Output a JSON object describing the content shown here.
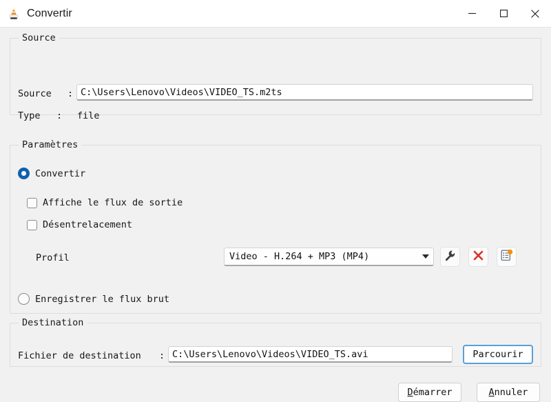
{
  "window": {
    "title": "Convertir",
    "app_icon": "vlc-cone-icon",
    "controls": {
      "minimize": "minimize-icon",
      "maximize": "maximize-icon",
      "close": "close-icon"
    }
  },
  "source": {
    "group_title": "Source",
    "source_label": "Source",
    "source_separator": ":",
    "source_value": "C:\\Users\\Lenovo\\Videos\\VIDEO_TS.m2ts",
    "type_label": "Type",
    "type_separator": ":",
    "type_value": "file"
  },
  "settings": {
    "group_title": "Paramètres",
    "convert_radio": {
      "label": "Convertir",
      "selected": true
    },
    "display_output_checkbox": {
      "label": "Affiche le flux de sortie",
      "checked": false
    },
    "deinterlace_checkbox": {
      "label": "Désentrelacement",
      "checked": false
    },
    "profile_label": "Profil",
    "profile_value": "Video - H.264 + MP3 (MP4)",
    "profile_buttons": {
      "edit": "wrench-icon",
      "delete": "red-x-icon",
      "new": "new-profile-icon"
    },
    "dump_radio": {
      "label": "Enregistrer le flux brut",
      "selected": false
    }
  },
  "destination": {
    "group_title": "Destination",
    "file_label": "Fichier de destination",
    "file_separator": ":",
    "file_value": "C:\\Users\\Lenovo\\Videos\\VIDEO_TS.avi",
    "browse_label": "Parcourir"
  },
  "footer": {
    "start_label_mnemonic": "D",
    "start_label_rest": "émarrer",
    "cancel_label_mnemonic": "A",
    "cancel_label_rest": "nnuler"
  },
  "colors": {
    "accent": "#0f60ae",
    "cone_orange": "#f08d1c",
    "delete_red": "#d93025",
    "badge_orange": "#f29010",
    "focus_blue": "#5a9fd8",
    "window_bg": "#f1f1f1"
  }
}
